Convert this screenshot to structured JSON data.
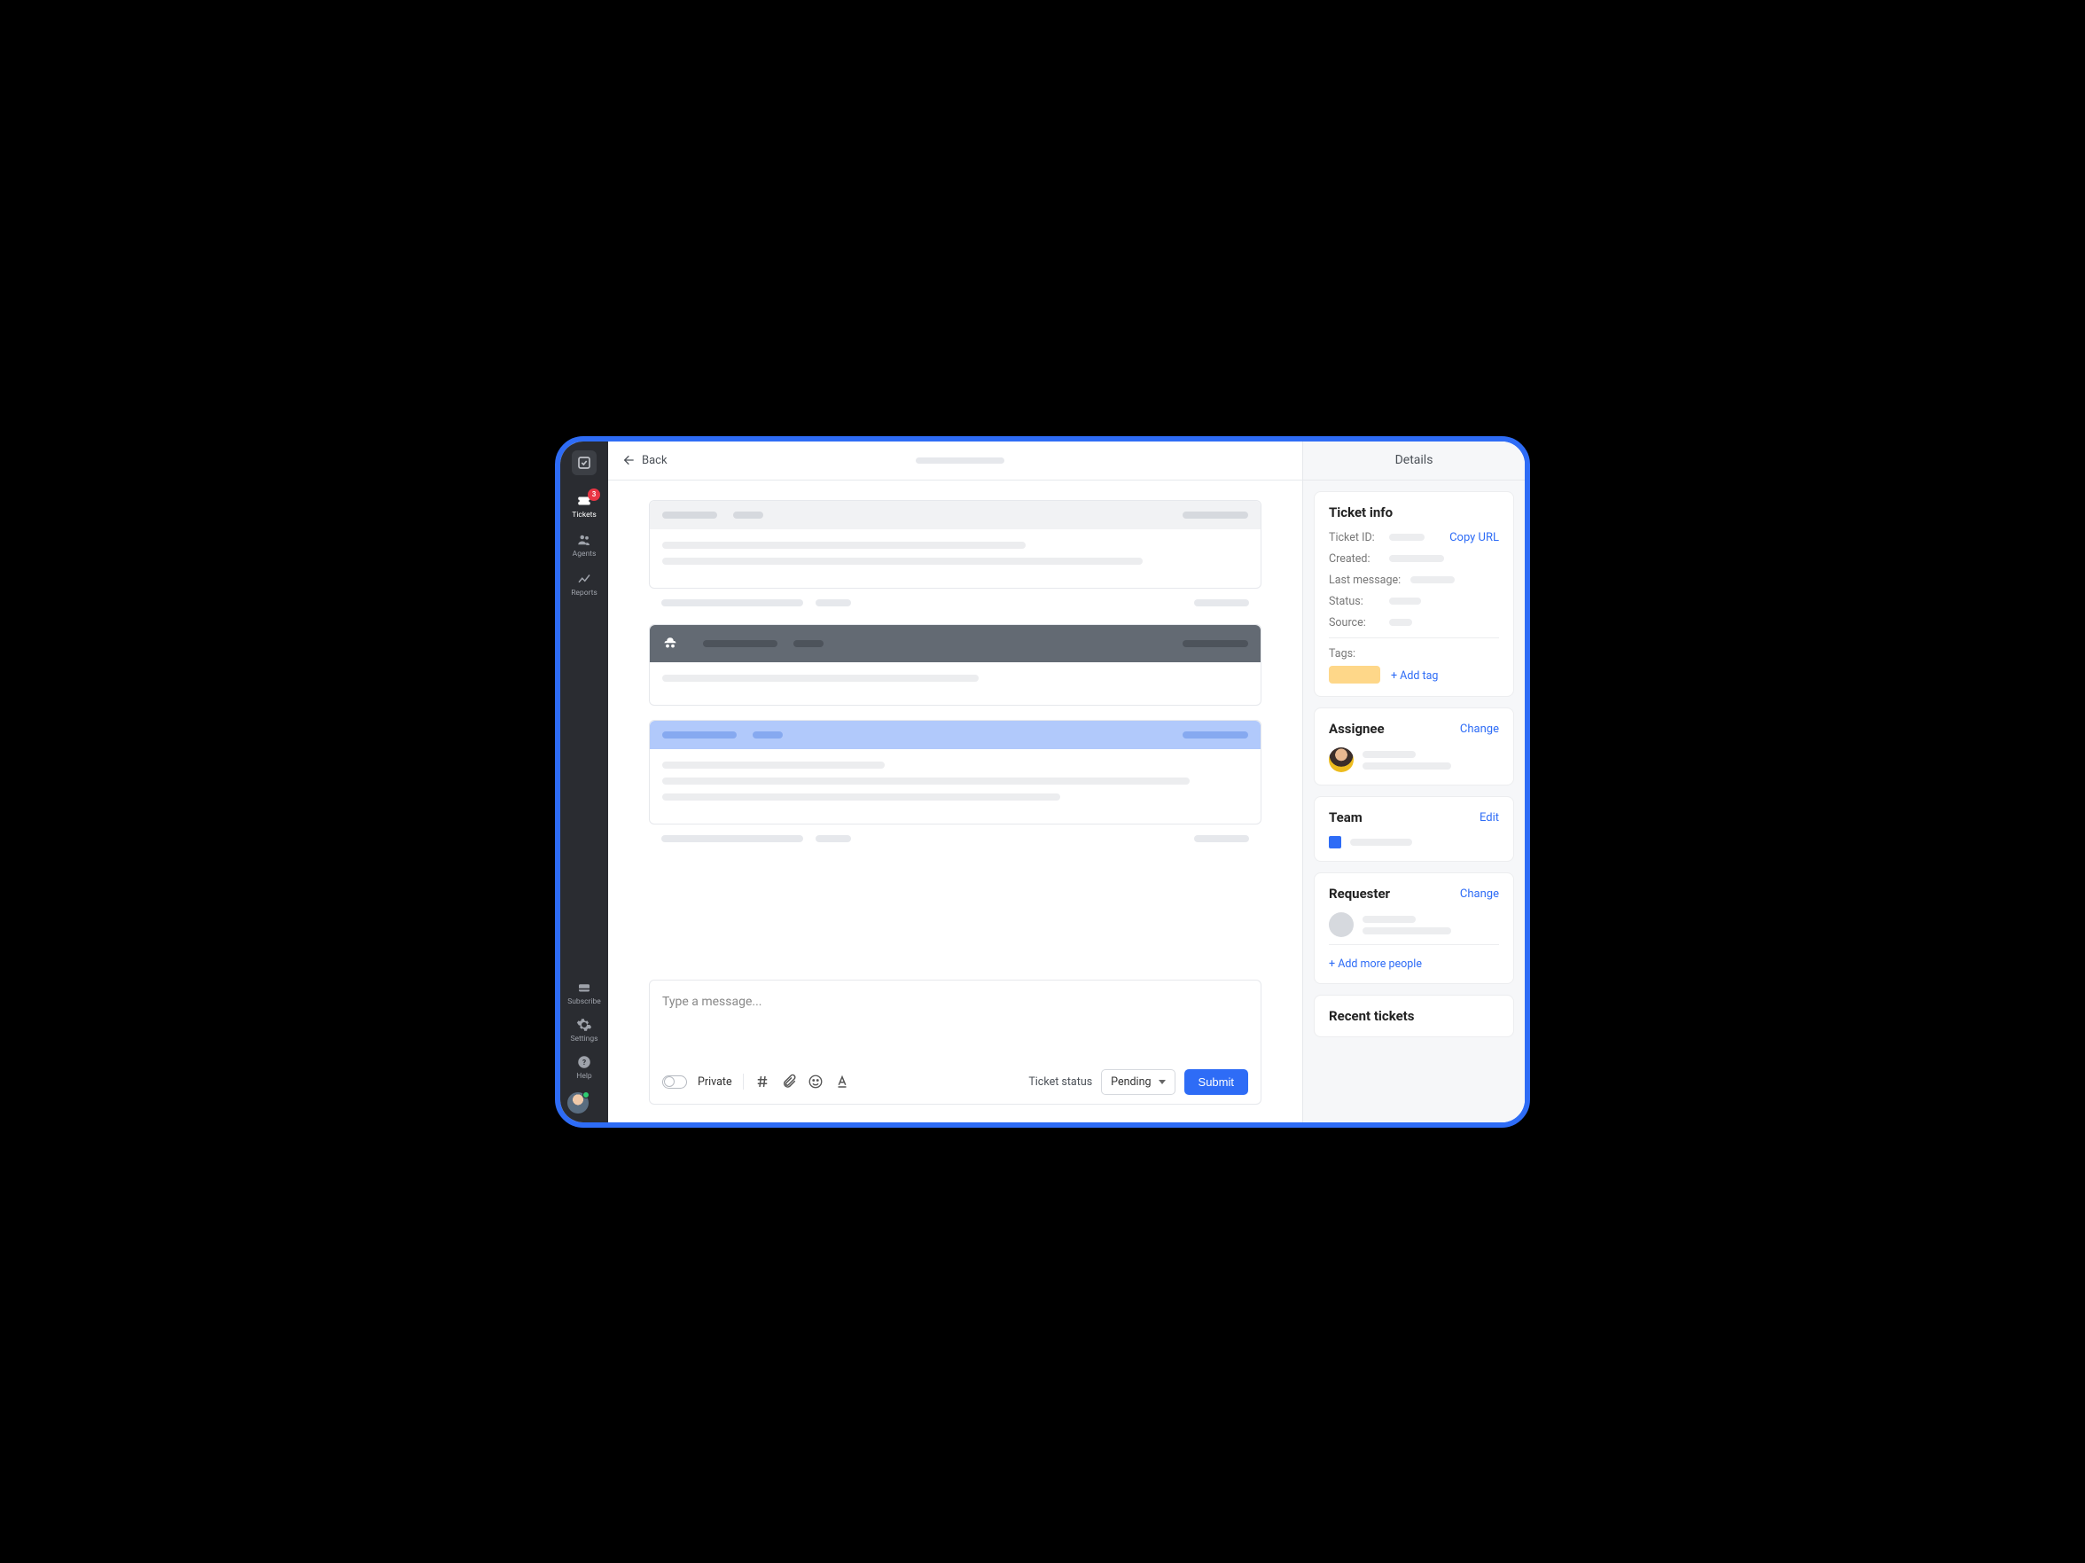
{
  "sidebar": {
    "items": [
      {
        "label": "Tickets",
        "badge": "3"
      },
      {
        "label": "Agents"
      },
      {
        "label": "Reports"
      }
    ],
    "bottom": [
      {
        "label": "Subscribe"
      },
      {
        "label": "Settings"
      },
      {
        "label": "Help"
      }
    ]
  },
  "topbar": {
    "back": "Back"
  },
  "composer": {
    "placeholder": "Type a message...",
    "private_label": "Private",
    "status_label": "Ticket status",
    "status_value": "Pending",
    "submit": "Submit"
  },
  "details": {
    "title": "Details",
    "ticket_info": {
      "title": "Ticket info",
      "rows": {
        "ticket_id": "Ticket ID:",
        "created": "Created:",
        "last_message": "Last message:",
        "status": "Status:",
        "source": "Source:"
      },
      "copy_url": "Copy URL",
      "tags_label": "Tags:",
      "add_tag": "+ Add tag"
    },
    "assignee": {
      "title": "Assignee",
      "action": "Change"
    },
    "team": {
      "title": "Team",
      "action": "Edit"
    },
    "requester": {
      "title": "Requester",
      "action": "Change",
      "add_more": "+ Add more people"
    },
    "recent": {
      "title": "Recent tickets"
    }
  }
}
